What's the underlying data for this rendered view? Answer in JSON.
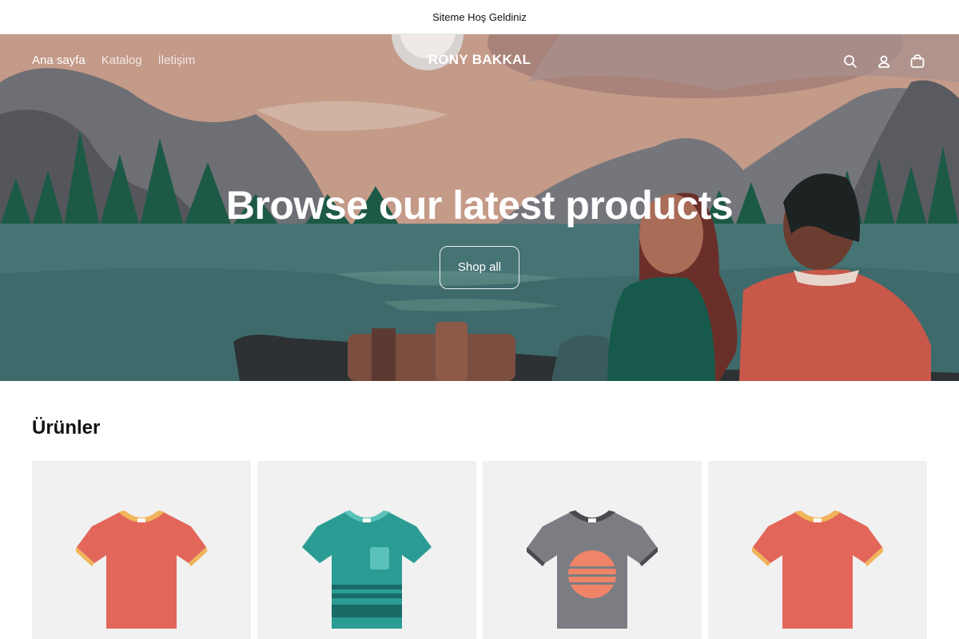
{
  "announcement": {
    "text": "Siteme Hoş Geldiniz"
  },
  "header": {
    "nav": [
      {
        "label": "Ana sayfa",
        "active": true
      },
      {
        "label": "Katalog",
        "active": false
      },
      {
        "label": "İletişim",
        "active": false
      }
    ],
    "logo": "RONY BAKKAL",
    "icons": [
      "search-icon",
      "account-icon",
      "cart-icon"
    ]
  },
  "hero": {
    "title": "Browse our latest products",
    "button_label": "Shop all"
  },
  "products": {
    "heading": "Ürünler",
    "items": [
      {
        "icon": "tshirt-icon",
        "color": "#e2675a",
        "trim": "#f0b45b"
      },
      {
        "icon": "tshirt-icon",
        "color": "#2b9c94",
        "trim": "#5ac2b8"
      },
      {
        "icon": "tshirt-icon",
        "color": "#7b7d83",
        "trim": "#4a4b50"
      },
      {
        "icon": "tshirt-icon",
        "color": "#e2675a",
        "trim": "#f0b45b"
      }
    ]
  }
}
